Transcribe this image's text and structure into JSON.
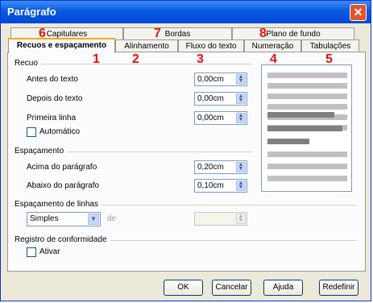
{
  "window": {
    "title": "Parágrafo",
    "close_glyph": "✕"
  },
  "tabs_row1": [
    {
      "label": "Capitulares"
    },
    {
      "label": "Bordas"
    },
    {
      "label": "Plano de fundo"
    }
  ],
  "tabs_row2": [
    {
      "label": "Recuos e espaçamento",
      "active": true
    },
    {
      "label": "Alinhamento"
    },
    {
      "label": "Fluxo do texto"
    },
    {
      "label": "Numeração"
    },
    {
      "label": "Tabulações"
    }
  ],
  "markers": [
    "6",
    "7",
    "8",
    "1",
    "2",
    "3",
    "4",
    "5"
  ],
  "indent": {
    "heading": "Recuo",
    "before_label": "Antes do texto",
    "before_value": "0,00cm",
    "after_label": "Depois do texto",
    "after_value": "0,00cm",
    "first_label": "Primeira linha",
    "first_value": "0,00cm",
    "auto_label": "Automático"
  },
  "spacing": {
    "heading": "Espaçamento",
    "above_label": "Acima do parágrafo",
    "above_value": "0,20cm",
    "below_label": "Abaixo do parágrafo",
    "below_value": "0,10cm"
  },
  "line_spacing": {
    "heading": "Espaçamento de linhas",
    "selected": "Simples",
    "of_label": "de",
    "of_value": ""
  },
  "register": {
    "heading": "Registro de conformidade",
    "activate_label": "Ativar"
  },
  "buttons": {
    "ok": "OK",
    "cancel": "Cancelar",
    "help": "Ajuda",
    "reset": "Redefinir"
  },
  "colors": {
    "accent_red": "#e8130b",
    "title_blue": "#0a5ae0",
    "preview_light": "#c0c0c0",
    "preview_dark": "#808080"
  }
}
